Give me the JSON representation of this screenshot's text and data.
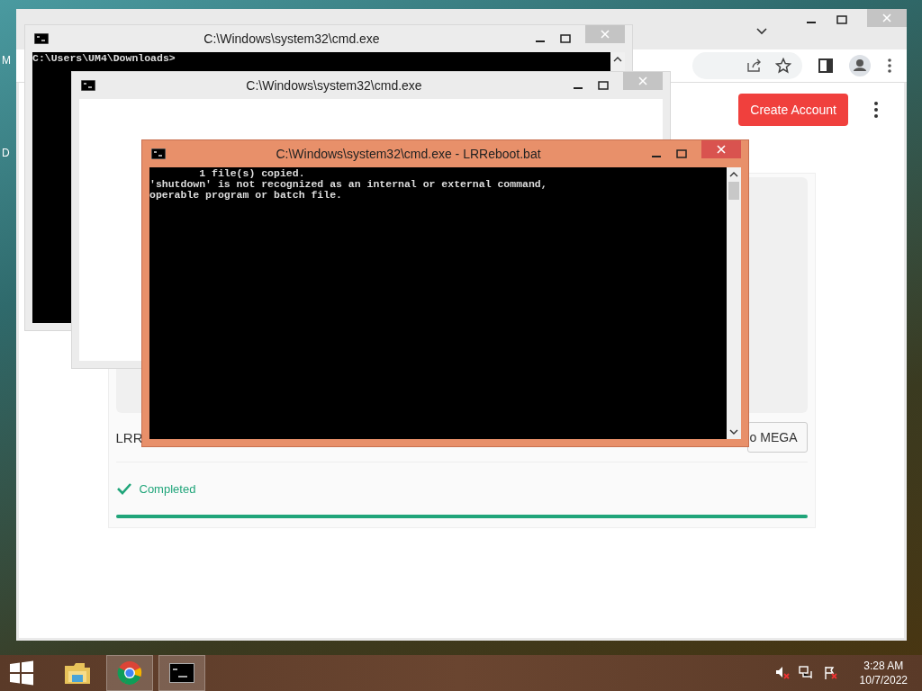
{
  "desktop": {
    "icon_labels": [
      "M",
      "D"
    ]
  },
  "browser": {
    "create_account": "Create Account",
    "file_name": "LRR",
    "save_button": "o MEGA",
    "status": "Completed",
    "progress": {
      "level": 1
    }
  },
  "windows": [
    {
      "title": "C:\\Windows\\system32\\cmd.exe",
      "kind": "console",
      "active": false,
      "lines": [
        "C:\\Users\\UM4\\Downloads>"
      ]
    },
    {
      "title": "C:\\Windows\\system32\\cmd.exe",
      "kind": "blank",
      "active": false
    },
    {
      "title": "C:\\Windows\\system32\\cmd.exe - LRReboot.bat",
      "kind": "console",
      "active": true,
      "lines": [
        "        1 file(s) copied.",
        "'shutdown' is not recognized as an internal or external command,",
        "operable program or batch file."
      ]
    }
  ],
  "taskbar": {
    "items": [
      {
        "kind": "folder",
        "running": false
      },
      {
        "kind": "chrome",
        "running": true
      },
      {
        "kind": "cmd",
        "running": true
      }
    ],
    "time": "3:28 AM",
    "date": "10/7/2022"
  }
}
